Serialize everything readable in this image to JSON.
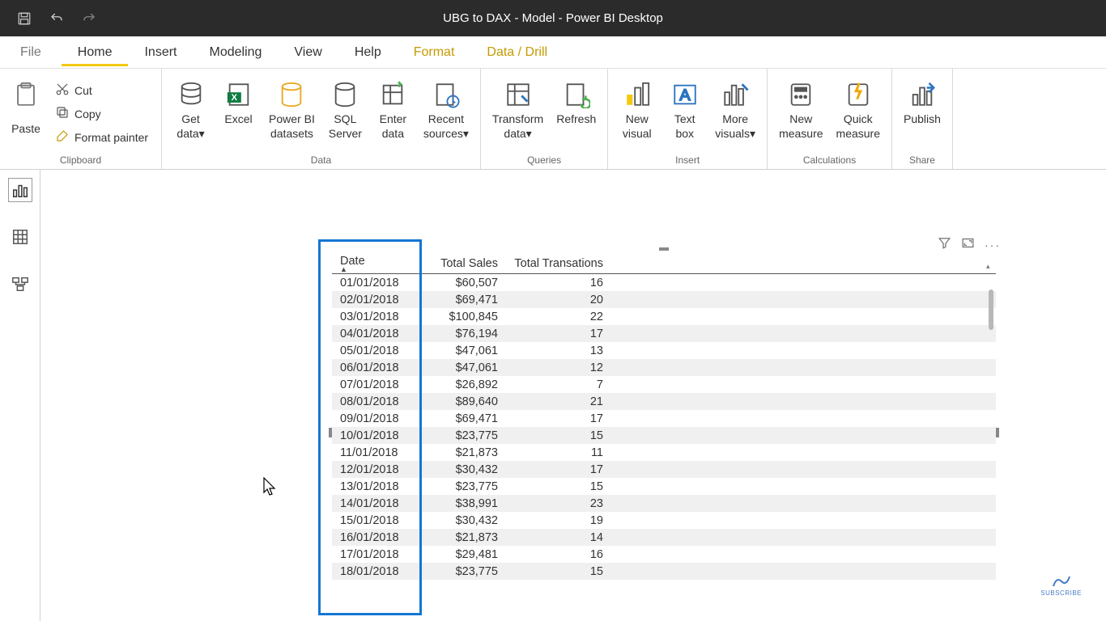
{
  "title": "UBG to DAX - Model - Power BI Desktop",
  "menu": {
    "file": "File",
    "home": "Home",
    "insert": "Insert",
    "modeling": "Modeling",
    "view": "View",
    "help": "Help",
    "format": "Format",
    "datadrill": "Data / Drill"
  },
  "ribbon": {
    "clipboard": {
      "paste": "Paste",
      "cut": "Cut",
      "copy": "Copy",
      "format_painter": "Format painter",
      "group": "Clipboard"
    },
    "data": {
      "get_data": "Get\ndata",
      "excel": "Excel",
      "powerbi_datasets": "Power BI\ndatasets",
      "sql_server": "SQL\nServer",
      "enter_data": "Enter\ndata",
      "recent_sources": "Recent\nsources",
      "group": "Data"
    },
    "queries": {
      "transform_data": "Transform\ndata",
      "refresh": "Refresh",
      "group": "Queries"
    },
    "insert": {
      "new_visual": "New\nvisual",
      "text_box": "Text\nbox",
      "more_visuals": "More\nvisuals",
      "group": "Insert"
    },
    "calculations": {
      "new_measure": "New\nmeasure",
      "quick_measure": "Quick\nmeasure",
      "group": "Calculations"
    },
    "share": {
      "publish": "Publish",
      "group": "Share"
    }
  },
  "table": {
    "headers": {
      "date": "Date",
      "sales": "Total Sales",
      "trans": "Total Transations"
    },
    "rows": [
      {
        "date": "01/01/2018",
        "sales": "$60,507",
        "trans": "16"
      },
      {
        "date": "02/01/2018",
        "sales": "$69,471",
        "trans": "20"
      },
      {
        "date": "03/01/2018",
        "sales": "$100,845",
        "trans": "22"
      },
      {
        "date": "04/01/2018",
        "sales": "$76,194",
        "trans": "17"
      },
      {
        "date": "05/01/2018",
        "sales": "$47,061",
        "trans": "13"
      },
      {
        "date": "06/01/2018",
        "sales": "$47,061",
        "trans": "12"
      },
      {
        "date": "07/01/2018",
        "sales": "$26,892",
        "trans": "7"
      },
      {
        "date": "08/01/2018",
        "sales": "$89,640",
        "trans": "21"
      },
      {
        "date": "09/01/2018",
        "sales": "$69,471",
        "trans": "17"
      },
      {
        "date": "10/01/2018",
        "sales": "$23,775",
        "trans": "15"
      },
      {
        "date": "11/01/2018",
        "sales": "$21,873",
        "trans": "11"
      },
      {
        "date": "12/01/2018",
        "sales": "$30,432",
        "trans": "17"
      },
      {
        "date": "13/01/2018",
        "sales": "$23,775",
        "trans": "15"
      },
      {
        "date": "14/01/2018",
        "sales": "$38,991",
        "trans": "23"
      },
      {
        "date": "15/01/2018",
        "sales": "$30,432",
        "trans": "19"
      },
      {
        "date": "16/01/2018",
        "sales": "$21,873",
        "trans": "14"
      },
      {
        "date": "17/01/2018",
        "sales": "$29,481",
        "trans": "16"
      },
      {
        "date": "18/01/2018",
        "sales": "$23,775",
        "trans": "15"
      }
    ]
  },
  "subscribe": "SUBSCRIBE"
}
